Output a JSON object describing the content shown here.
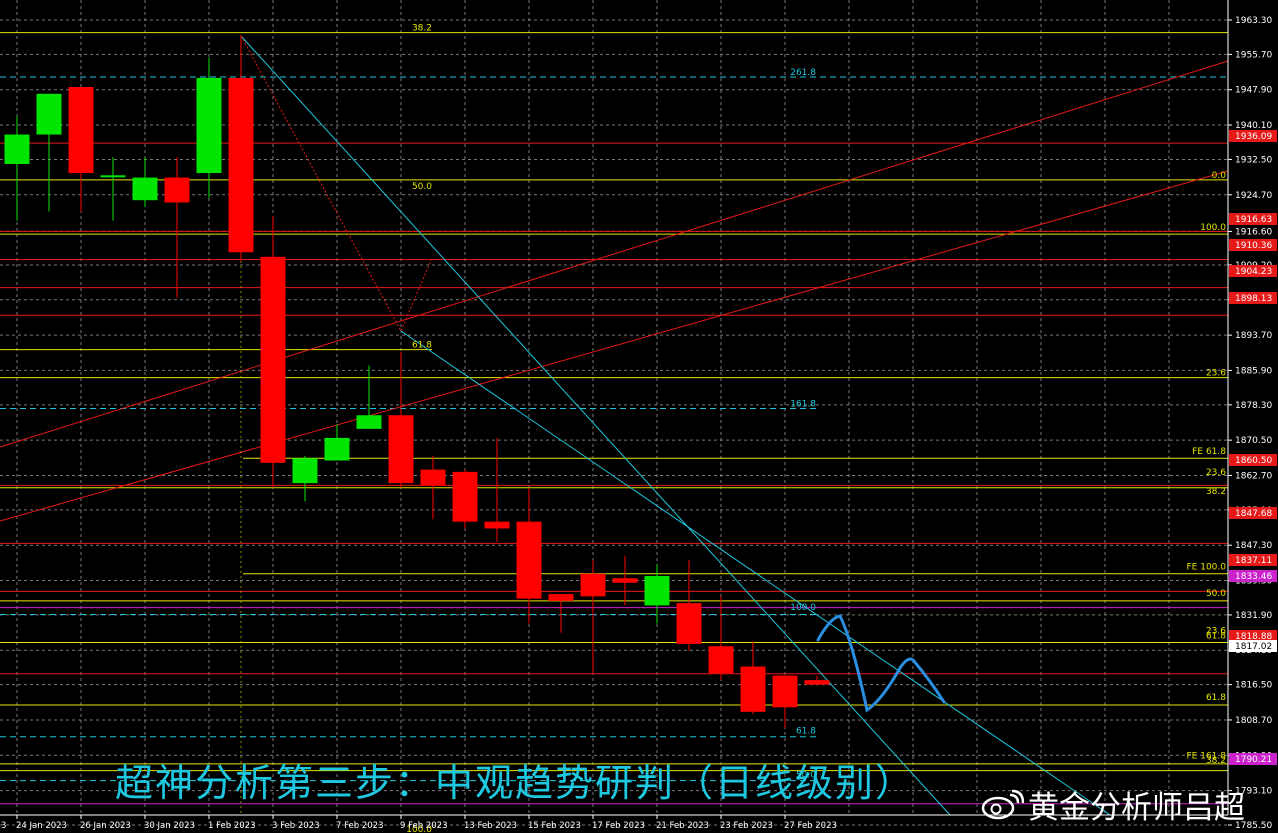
{
  "chart_data": {
    "type": "candlestick",
    "grid": true,
    "price_range": [
      1779.0,
      1968.0
    ],
    "y_tick_labels": [
      "1963.30",
      "1955.70",
      "1947.90",
      "1940.10",
      "1932.50",
      "1924.70",
      "1916.60",
      "1909.20",
      "1901.50",
      "1893.70",
      "1885.90",
      "1878.30",
      "1870.50",
      "1862.70",
      "1855.10",
      "1847.30",
      "1839.50",
      "1831.90",
      "1824.10",
      "1816.50",
      "1808.70",
      "1800.90",
      "1793.10",
      "1785.50"
    ],
    "x_labels": [
      "24 Jan 2023",
      "26 Jan 2023",
      "30 Jan 2023",
      "1 Feb 2023",
      "3 Feb 2023",
      "7 Feb 2023",
      "9 Feb 2023",
      "13 Feb 2023",
      "15 Feb 2023",
      "17 Feb 2023",
      "21 Feb 2023",
      "23 Feb 2023",
      "27 Feb 2023"
    ],
    "x_axis_left_fragment": "3",
    "candles": [
      {
        "o": 1931.5,
        "h": 1942.0,
        "l": 1919.0,
        "c": 1938.0
      },
      {
        "o": 1938.0,
        "h": 1946.5,
        "l": 1921.0,
        "c": 1947.0
      },
      {
        "o": 1948.5,
        "h": 1947.0,
        "l": 1921.0,
        "c": 1929.5
      },
      {
        "o": 1929.0,
        "h": 1933.0,
        "l": 1919.0,
        "c": 1929.0
      },
      {
        "o": 1923.5,
        "h": 1933.0,
        "l": 1922.0,
        "c": 1928.5
      },
      {
        "o": 1928.5,
        "h": 1933.0,
        "l": 1902.0,
        "c": 1923.0
      },
      {
        "o": 1929.5,
        "h": 1955.0,
        "l": 1924.0,
        "c": 1950.5
      },
      {
        "o": 1950.5,
        "h": 1960.0,
        "l": 1910.0,
        "c": 1912.0
      },
      {
        "o": 1911.0,
        "h": 1920.0,
        "l": 1860.0,
        "c": 1865.5
      },
      {
        "o": 1861.0,
        "h": 1867.0,
        "l": 1857.0,
        "c": 1866.5
      },
      {
        "o": 1866.0,
        "h": 1874.0,
        "l": 1866.0,
        "c": 1871.0
      },
      {
        "o": 1873.0,
        "h": 1887.0,
        "l": 1873.0,
        "c": 1876.0
      },
      {
        "o": 1876.0,
        "h": 1890.0,
        "l": 1860.0,
        "c": 1861.0
      },
      {
        "o": 1864.0,
        "h": 1867.0,
        "l": 1853.0,
        "c": 1860.5
      },
      {
        "o": 1863.5,
        "h": 1864.0,
        "l": 1851.0,
        "c": 1852.5
      },
      {
        "o": 1852.5,
        "h": 1871.0,
        "l": 1848.0,
        "c": 1851.0
      },
      {
        "o": 1852.5,
        "h": 1860.0,
        "l": 1830.0,
        "c": 1835.5
      },
      {
        "o": 1836.5,
        "h": 1836.5,
        "l": 1828.0,
        "c": 1835.0
      },
      {
        "o": 1841.0,
        "h": 1844.0,
        "l": 1819.0,
        "c": 1836.0
      },
      {
        "o": 1840.0,
        "h": 1845.0,
        "l": 1834.0,
        "c": 1839.0
      },
      {
        "o": 1834.0,
        "h": 1843.0,
        "l": 1830.0,
        "c": 1840.5
      },
      {
        "o": 1834.5,
        "h": 1844.0,
        "l": 1824.0,
        "c": 1825.5
      },
      {
        "o": 1825.0,
        "h": 1836.0,
        "l": 1817.5,
        "c": 1819.0
      },
      {
        "o": 1820.5,
        "h": 1826.0,
        "l": 1810.0,
        "c": 1810.5
      },
      {
        "o": 1818.5,
        "h": 1818.5,
        "l": 1807.0,
        "c": 1811.5
      },
      {
        "o": 1817.5,
        "h": 1818.5,
        "l": 1816.5,
        "c": 1816.5
      }
    ],
    "price_badges": [
      {
        "label": "1936.09",
        "color": "#e61919"
      },
      {
        "label": "1916.63",
        "color": "#e61919"
      },
      {
        "label": "1910.36",
        "color": "#e61919"
      },
      {
        "label": "1904.23",
        "color": "#e61919"
      },
      {
        "label": "1898.13",
        "color": "#e61919"
      },
      {
        "label": "1860.50",
        "color": "#e61919"
      },
      {
        "label": "1847.68",
        "color": "#e61919"
      },
      {
        "label": "1837.11",
        "color": "#e61919"
      },
      {
        "label": "1833.46",
        "color": "#cc22cc"
      },
      {
        "label": "1818.88",
        "color": "#e61919"
      },
      {
        "label": "1817.02",
        "color": "#ffffff"
      },
      {
        "label": "1790.21",
        "color": "#cc22cc"
      }
    ],
    "level_labels": [
      {
        "text": "38.2",
        "price": 1960.5,
        "color": "#e6e600",
        "pos": "left"
      },
      {
        "text": "261.8",
        "price": 1950.7,
        "color": "#1ec8e0",
        "pos": "mid"
      },
      {
        "text": "50.0",
        "price": 1925.5,
        "color": "#e6e600",
        "pos": "left"
      },
      {
        "text": "0.0",
        "price": 1928.0,
        "color": "#e6e600",
        "pos": "right"
      },
      {
        "text": "100.0",
        "price": 1916.5,
        "color": "#e6e600",
        "pos": "right"
      },
      {
        "text": "61.8",
        "price": 1890.5,
        "color": "#e6e600",
        "pos": "left"
      },
      {
        "text": "23.6",
        "price": 1884.3,
        "color": "#e6e600",
        "pos": "right"
      },
      {
        "text": "161.8",
        "price": 1877.5,
        "color": "#1ec8e0",
        "pos": "mid"
      },
      {
        "text": "FE 61.8",
        "price": 1867.0,
        "color": "#e6e600",
        "pos": "right"
      },
      {
        "text": "23.6",
        "price": 1862.4,
        "color": "#e6e600",
        "pos": "right"
      },
      {
        "text": "38.2",
        "price": 1858.2,
        "color": "#e6e600",
        "pos": "right"
      },
      {
        "text": "FE 100.0",
        "price": 1841.5,
        "color": "#e6e600",
        "pos": "right"
      },
      {
        "text": "50.0",
        "price": 1835.6,
        "color": "#e6e600",
        "pos": "right"
      },
      {
        "text": "100.0",
        "price": 1832.5,
        "color": "#1ec8e0",
        "pos": "mid"
      },
      {
        "text": "23.6",
        "price": 1827.4,
        "color": "#e6e600",
        "pos": "right"
      },
      {
        "text": "61.8",
        "price": 1826.2,
        "color": "#e6e600",
        "pos": "right"
      },
      {
        "text": "61.8",
        "price": 1812.7,
        "color": "#e6e600",
        "pos": "right"
      },
      {
        "text": "61.8",
        "price": 1805.3,
        "color": "#1ec8e0",
        "pos": "mid"
      },
      {
        "text": "FE 161.8",
        "price": 1799.8,
        "color": "#e6e600",
        "pos": "right"
      },
      {
        "text": "38.2",
        "price": 1798.7,
        "color": "#e6e600",
        "pos": "right"
      },
      {
        "text": "50.0",
        "price": 1795.6,
        "color": "#1ec8e0",
        "pos": "mid"
      },
      {
        "text": "100.0",
        "price": 1783.5,
        "color": "#e6e600",
        "pos": "left"
      }
    ],
    "colors": {
      "bull": "#00e600",
      "bear": "#ff0000",
      "grid": "#7a7a7a",
      "axis_text": "#ffffff",
      "fib": "#e6e600",
      "fib_ext": "#1ec8e0",
      "trend": "#e61919",
      "projection": "#2a8fe0"
    }
  },
  "caption": "超神分析第三步：中观趋势研判（日线级别）",
  "watermark": "黄金分析师吕超"
}
